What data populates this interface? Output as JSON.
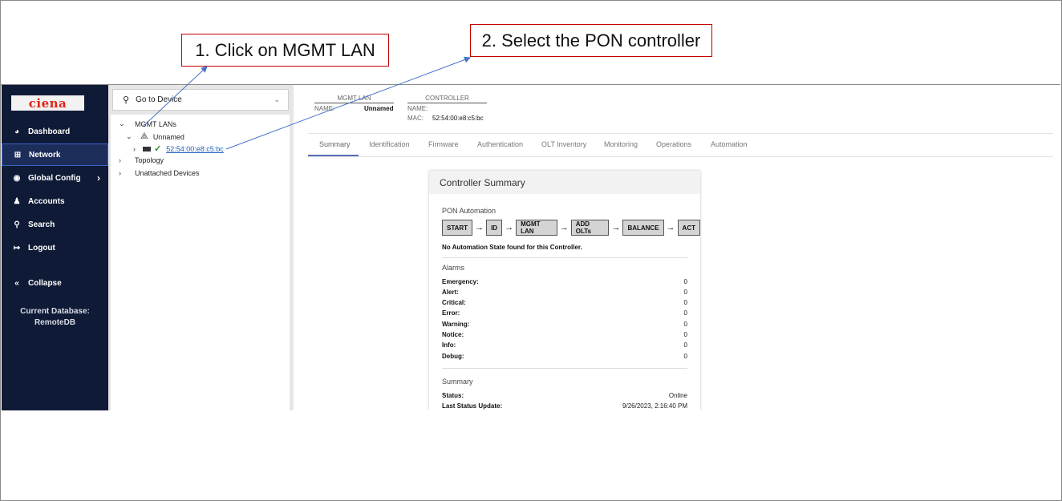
{
  "callouts": {
    "step1": "1. Click on MGMT LAN",
    "step2": "2. Select the PON controller"
  },
  "sidebar": {
    "logo": "ciena",
    "items": [
      {
        "label": "Dashboard",
        "icon": "dashboard-icon",
        "glyph": "◕"
      },
      {
        "label": "Network",
        "icon": "network-icon",
        "glyph": "⊞"
      },
      {
        "label": "Global Config",
        "icon": "globe-icon",
        "glyph": "◉"
      },
      {
        "label": "Accounts",
        "icon": "users-icon",
        "glyph": "♟"
      },
      {
        "label": "Search",
        "icon": "search-icon",
        "glyph": "⚲"
      },
      {
        "label": "Logout",
        "icon": "logout-icon",
        "glyph": "↦"
      },
      {
        "label": "Collapse",
        "icon": "collapse-icon",
        "glyph": "«"
      }
    ],
    "db_label": "Current Database:",
    "db_name": "RemoteDB"
  },
  "tree": {
    "search_placeholder": "Go to Device",
    "mgmt_lans": "MGMT LANs",
    "lan_name": "Unnamed",
    "controller_mac": "52:54:00:e8:c5:bc",
    "topology": "Topology",
    "unattached": "Unattached Devices"
  },
  "header": {
    "mgmt_lan_head": "MGMT LAN",
    "mgmt_lan_name_label": "NAME:",
    "mgmt_lan_name": "Unnamed",
    "controller_head": "CONTROLLER",
    "controller_name_label": "NAME:",
    "controller_mac_label": "MAC:",
    "controller_mac": "52:54:00:e8:c5:bc"
  },
  "tabs": [
    "Summary",
    "Identification",
    "Firmware",
    "Authentication",
    "OLT Inventory",
    "Monitoring",
    "Operations",
    "Automation"
  ],
  "card": {
    "title": "Controller Summary",
    "automation_title": "PON Automation",
    "steps": [
      "START",
      "ID",
      "MGMT LAN",
      "ADD OLTs",
      "BALANCE",
      "ACT"
    ],
    "note": "No Automation State found for this Controller.",
    "alarms_title": "Alarms",
    "alarms": [
      {
        "k": "Emergency:",
        "v": "0"
      },
      {
        "k": "Alert:",
        "v": "0"
      },
      {
        "k": "Critical:",
        "v": "0"
      },
      {
        "k": "Error:",
        "v": "0"
      },
      {
        "k": "Warning:",
        "v": "0"
      },
      {
        "k": "Notice:",
        "v": "0"
      },
      {
        "k": "Info:",
        "v": "0"
      },
      {
        "k": "Debug:",
        "v": "0"
      }
    ],
    "summary_title": "Summary",
    "status_label": "Status:",
    "status_value": "Online",
    "last_update_label": "Last Status Update:",
    "last_update_value": "9/26/2023, 2:16:40 PM"
  },
  "colors": {
    "sidebar_bg": "#0f1a36",
    "callout_border": "#c00000",
    "annotation_arrow": "#4472c4",
    "link": "#1f5fbf"
  }
}
